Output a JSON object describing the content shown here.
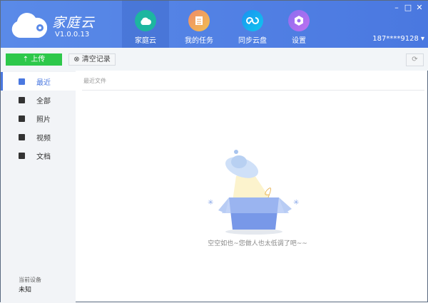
{
  "app": {
    "title": "家庭云",
    "version": "V1.0.0.13"
  },
  "tabs": [
    {
      "label": "家庭云",
      "color": "#1db6a0"
    },
    {
      "label": "我的任务",
      "color": "#f0a05a"
    },
    {
      "label": "同步云盘",
      "color": "#1aa8f0"
    },
    {
      "label": "设置",
      "color": "#9a6ef0"
    }
  ],
  "user": "187****9128 ▾",
  "toolbar": {
    "upload": "⇡ 上传",
    "clear": "⊗ 清空记录",
    "refresh": "⟳"
  },
  "sidebar": {
    "items": [
      {
        "label": "最近"
      },
      {
        "label": "全部"
      },
      {
        "label": "照片"
      },
      {
        "label": "视频"
      },
      {
        "label": "文档"
      }
    ],
    "device_label": "当前设备",
    "device_value": "未知"
  },
  "main": {
    "breadcrumb": "最近文件",
    "empty_text": "空空如也~您做人也太低调了吧~~"
  }
}
